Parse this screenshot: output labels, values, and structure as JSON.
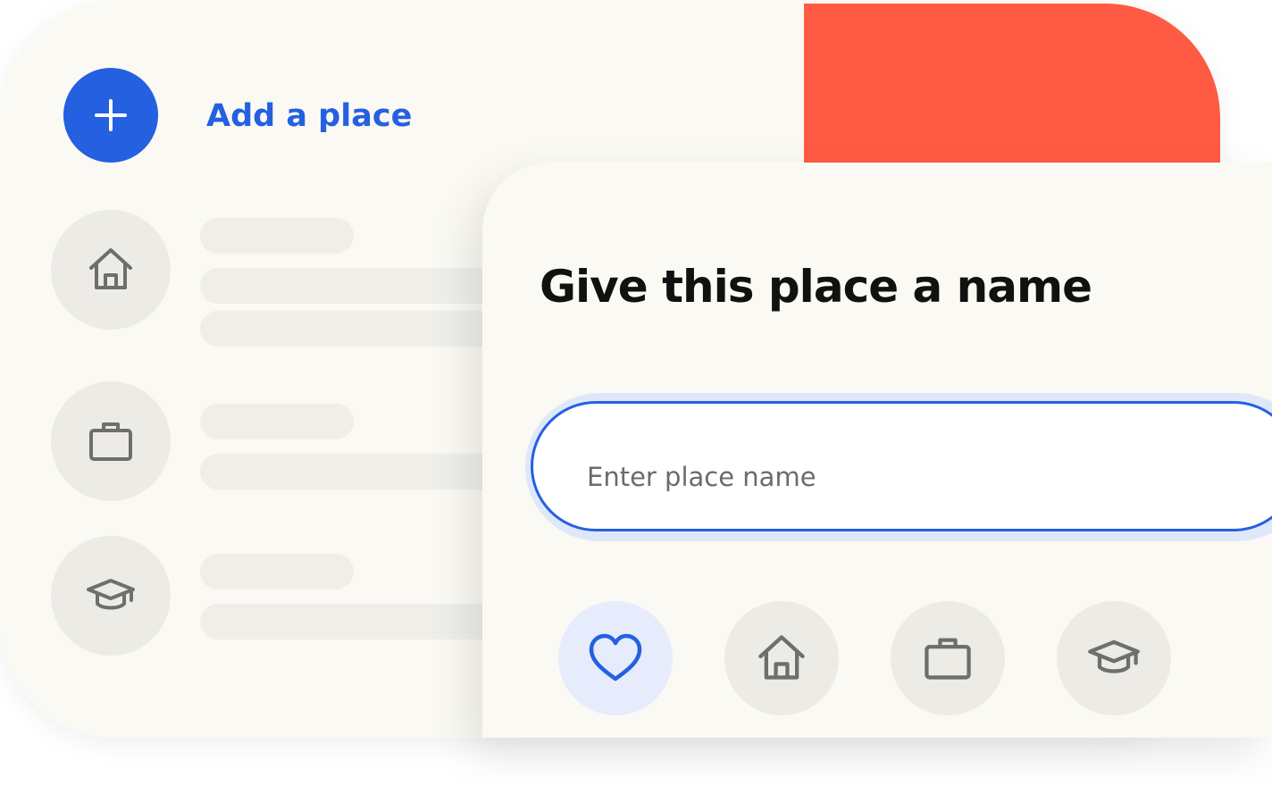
{
  "add_place": {
    "label": "Add a place",
    "icon": "plus-icon"
  },
  "colors": {
    "background": "#faf9f3",
    "accent": "#ff5a43",
    "primary": "#2460e0",
    "icon_gray": "#6e6e6e",
    "circle_gray": "#ecebe6",
    "selected_circle": "#e6ecfb"
  },
  "place_list": {
    "items": [
      {
        "icon": "home-icon"
      },
      {
        "icon": "briefcase-icon"
      },
      {
        "icon": "graduation-cap-icon"
      }
    ]
  },
  "dialog": {
    "title": "Give this place a name",
    "input": {
      "placeholder": "Enter place name",
      "value": ""
    },
    "icon_choices": [
      {
        "icon": "heart-icon",
        "selected": true
      },
      {
        "icon": "home-icon",
        "selected": false
      },
      {
        "icon": "briefcase-icon",
        "selected": false
      },
      {
        "icon": "graduation-cap-icon",
        "selected": false
      }
    ]
  }
}
